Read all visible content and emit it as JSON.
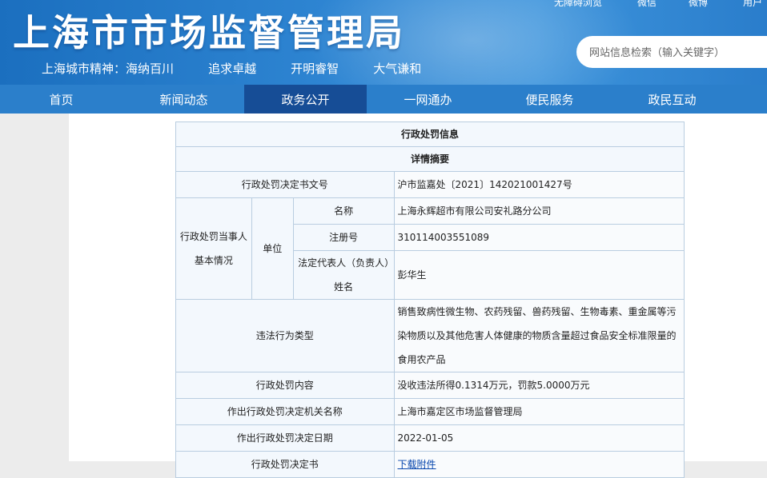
{
  "header": {
    "site_title": "上海市市场监督管理局",
    "slogan": "上海城市精神：海纳百川    追求卓越    开明睿智    大气谦和",
    "top_links": [
      "无障碍浏览",
      "微信",
      "微博",
      "用户"
    ],
    "search_placeholder": "网站信息检索（输入关键字）"
  },
  "nav": {
    "items": [
      "首页",
      "新闻动态",
      "政务公开",
      "一网通办",
      "便民服务",
      "政民互动"
    ],
    "active": "政务公开"
  },
  "table": {
    "title": "行政处罚信息",
    "subtitle": "详情摘要",
    "decision_no_label": "行政处罚决定书文号",
    "decision_no_value": "沪市监嘉处〔2021〕142021001427号",
    "party_label": "行政处罚当事人基本情况",
    "unit_label": "单位",
    "name_label": "名称",
    "name_value": "上海永辉超市有限公司安礼路分公司",
    "reg_label": "注册号",
    "reg_value": "310114003551089",
    "rep_label": "法定代表人（负责人）姓名",
    "rep_value": "彭华生",
    "violation_label": "违法行为类型",
    "violation_value": "销售致病性微生物、农药残留、兽药残留、生物毒素、重金属等污染物质以及其他危害人体健康的物质含量超过食品安全标准限量的食用农产品",
    "content_label": "行政处罚内容",
    "content_value": "没收违法所得0.1314万元，罚款5.0000万元",
    "authority_label": "作出行政处罚决定机关名称",
    "authority_value": "上海市嘉定区市场监督管理局",
    "date_label": "作出行政处罚决定日期",
    "date_value": "2022-01-05",
    "doc_label": "行政处罚决定书",
    "doc_link": "下载附件"
  }
}
